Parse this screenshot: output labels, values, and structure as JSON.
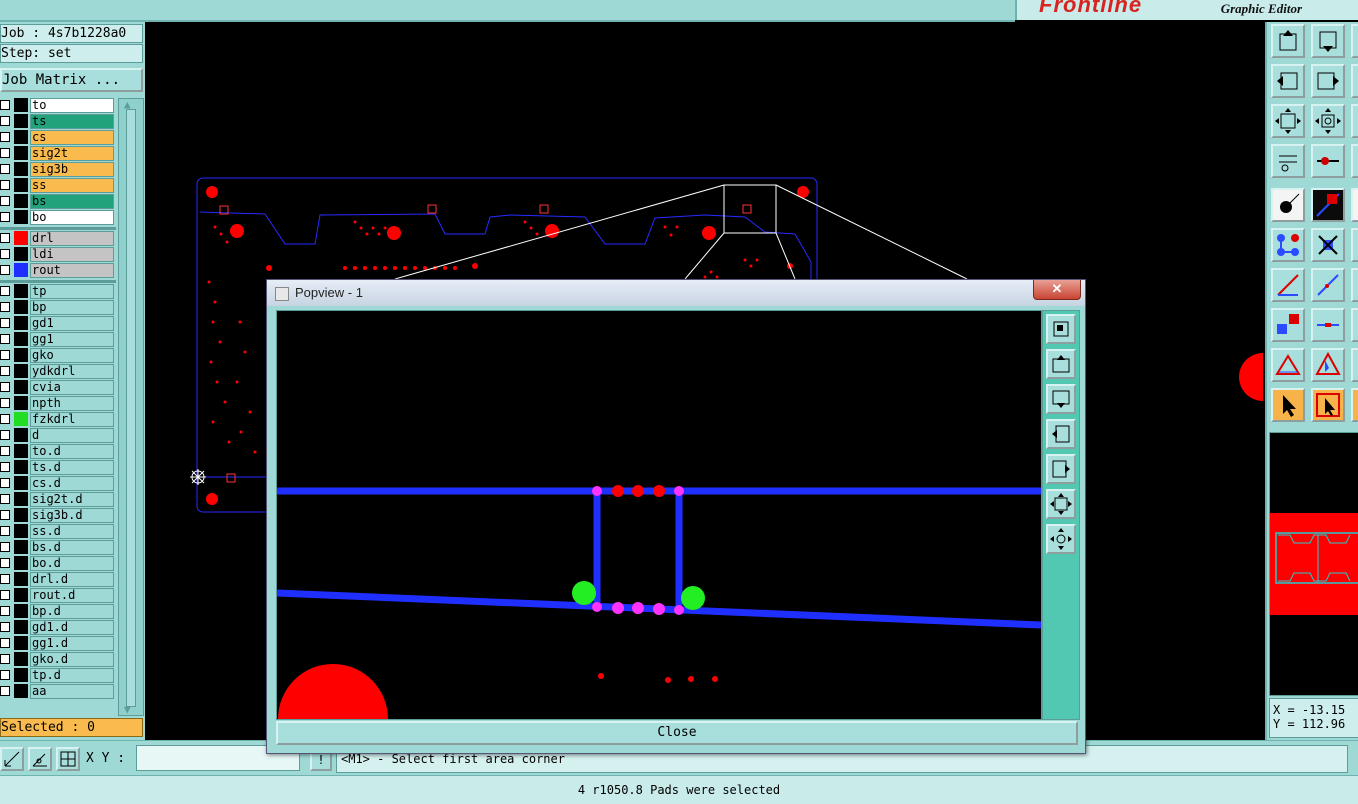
{
  "brand": {
    "logo": "Frontline",
    "title": "Graphic Editor"
  },
  "job": {
    "label": "Job : 4s7b1228a0",
    "step": "Step: set"
  },
  "job_matrix_button": "Job Matrix ...",
  "layers": [
    {
      "name": "to",
      "swatch": "#000000",
      "bg": "#ffffff"
    },
    {
      "name": "ts",
      "swatch": "#000000",
      "bg": "#21a27b"
    },
    {
      "name": "cs",
      "swatch": "#000000",
      "bg": "#f9bb4e"
    },
    {
      "name": "sig2t",
      "swatch": "#000000",
      "bg": "#f9bb4e"
    },
    {
      "name": "sig3b",
      "swatch": "#000000",
      "bg": "#f9bb4e"
    },
    {
      "name": "ss",
      "swatch": "#000000",
      "bg": "#f9bb4e"
    },
    {
      "name": "bs",
      "swatch": "#000000",
      "bg": "#21a27b"
    },
    {
      "name": "bo",
      "swatch": "#000000",
      "bg": "#ffffff"
    },
    {
      "name": "drl",
      "swatch": "#ff0000",
      "bg": "#c4c4c4"
    },
    {
      "name": "ldi",
      "swatch": "#000000",
      "bg": "#c4c4c4"
    },
    {
      "name": "rout",
      "swatch": "#1f2fff",
      "bg": "#c4c4c4"
    },
    {
      "name": "tp",
      "swatch": "#000000",
      "bg": "#9fd9d6"
    },
    {
      "name": "bp",
      "swatch": "#000000",
      "bg": "#9fd9d6"
    },
    {
      "name": "gd1",
      "swatch": "#000000",
      "bg": "#9fd9d6"
    },
    {
      "name": "gg1",
      "swatch": "#000000",
      "bg": "#9fd9d6"
    },
    {
      "name": "gko",
      "swatch": "#000000",
      "bg": "#9fd9d6"
    },
    {
      "name": "ydkdrl",
      "swatch": "#000000",
      "bg": "#9fd9d6"
    },
    {
      "name": "cvia",
      "swatch": "#000000",
      "bg": "#9fd9d6"
    },
    {
      "name": "npth",
      "swatch": "#000000",
      "bg": "#9fd9d6"
    },
    {
      "name": "fzkdrl",
      "swatch": "#22dd22",
      "bg": "#9fd9d6"
    },
    {
      "name": "d",
      "swatch": "#000000",
      "bg": "#9fd9d6"
    },
    {
      "name": "to.d",
      "swatch": "#000000",
      "bg": "#9fd9d6"
    },
    {
      "name": "ts.d",
      "swatch": "#000000",
      "bg": "#9fd9d6"
    },
    {
      "name": "cs.d",
      "swatch": "#000000",
      "bg": "#9fd9d6"
    },
    {
      "name": "sig2t.d",
      "swatch": "#000000",
      "bg": "#9fd9d6"
    },
    {
      "name": "sig3b.d",
      "swatch": "#000000",
      "bg": "#9fd9d6"
    },
    {
      "name": "ss.d",
      "swatch": "#000000",
      "bg": "#9fd9d6"
    },
    {
      "name": "bs.d",
      "swatch": "#000000",
      "bg": "#9fd9d6"
    },
    {
      "name": "bo.d",
      "swatch": "#000000",
      "bg": "#9fd9d6"
    },
    {
      "name": "drl.d",
      "swatch": "#000000",
      "bg": "#9fd9d6"
    },
    {
      "name": "rout.d",
      "swatch": "#000000",
      "bg": "#9fd9d6"
    },
    {
      "name": "bp.d",
      "swatch": "#000000",
      "bg": "#9fd9d6"
    },
    {
      "name": "gd1.d",
      "swatch": "#000000",
      "bg": "#9fd9d6"
    },
    {
      "name": "gg1.d",
      "swatch": "#000000",
      "bg": "#9fd9d6"
    },
    {
      "name": "gko.d",
      "swatch": "#000000",
      "bg": "#9fd9d6"
    },
    {
      "name": "tp.d",
      "swatch": "#000000",
      "bg": "#9fd9d6"
    },
    {
      "name": "aa",
      "swatch": "#000000",
      "bg": "#9fd9d6"
    }
  ],
  "selected": "Selected : 0",
  "xy_label": "X Y :",
  "prompt": "<M1> - Select first area corner",
  "status": "4 r1050.8 Pads were selected",
  "coords": {
    "x": "X = -13.15",
    "y": "Y = 112.96"
  },
  "popview": {
    "title": "Popview - 1",
    "close_label": "Close",
    "close_x": "✕"
  },
  "colors": {
    "panel": "#9fd9d6",
    "board_outline": "#2a2aff",
    "drill": "#ff0000",
    "trace": "#1f2fff",
    "pad_magenta": "#ff33ff",
    "pad_green": "#22ee22"
  }
}
